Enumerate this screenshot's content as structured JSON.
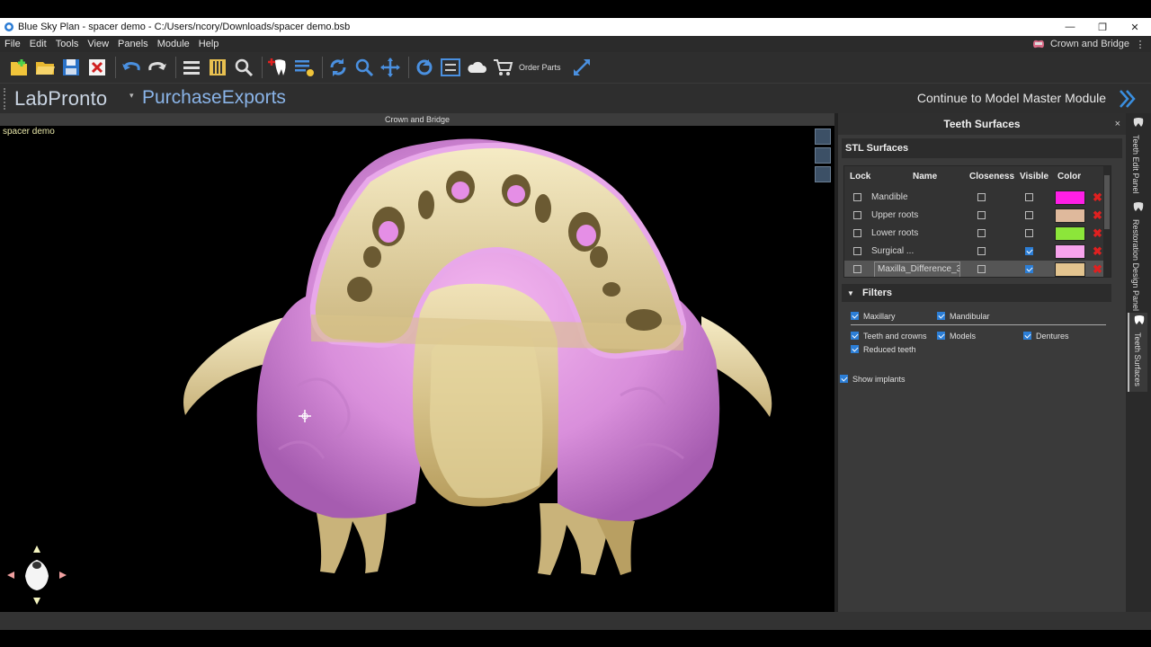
{
  "window": {
    "title": "Blue Sky Plan - spacer demo - C:/Users/ncory/Downloads/spacer demo.bsb",
    "min": "—",
    "max": "❐",
    "close": "✕"
  },
  "menu": {
    "items": [
      "File",
      "Edit",
      "Tools",
      "View",
      "Panels",
      "Module",
      "Help"
    ],
    "module_label": "Crown and Bridge",
    "overflow": "⋮"
  },
  "toolbar": {
    "order_parts_label": "Order Parts"
  },
  "brand": {
    "labpronto": "LabPronto",
    "purchase": "PurchaseExports",
    "continue_label": "Continue to Model Master Module"
  },
  "viewport": {
    "header": "Crown and Bridge",
    "scene_name": "spacer demo"
  },
  "panel": {
    "title": "Teeth Surfaces",
    "close": "×",
    "stl_title": "STL Surfaces",
    "columns": [
      "Lock",
      "Name",
      "Closeness",
      "Visible",
      "Color"
    ],
    "rows": [
      {
        "name": "Mandible",
        "lock": false,
        "closeness": false,
        "visible": false,
        "color": "#ff1fe6"
      },
      {
        "name": "Upper roots",
        "lock": false,
        "closeness": false,
        "visible": false,
        "color": "#dfb99c"
      },
      {
        "name": "Lower roots",
        "lock": false,
        "closeness": false,
        "visible": false,
        "color": "#8ce63a"
      },
      {
        "name": "Surgical ...",
        "lock": false,
        "closeness": false,
        "visible": true,
        "color": "#f7a3ec"
      },
      {
        "name": "Maxilla_Difference_3",
        "lock": false,
        "closeness": false,
        "visible": true,
        "color": "#e3c48f",
        "selected": true
      }
    ],
    "delete_glyph": "✖",
    "filters_title": "Filters",
    "filters_caret": "▼",
    "filters": [
      {
        "label": "Maxillary",
        "checked": true
      },
      {
        "label": "Mandibular",
        "checked": true
      },
      {
        "label": "Teeth and crowns",
        "checked": true
      },
      {
        "label": "Models",
        "checked": true
      },
      {
        "label": "Dentures",
        "checked": true
      },
      {
        "label": "Reduced teeth",
        "checked": true
      }
    ],
    "show_implants": {
      "label": "Show implants",
      "checked": true
    }
  },
  "side_tabs": [
    "Teeth Edit Panel",
    "Restoration Design Panel",
    "Teeth Surfaces"
  ]
}
